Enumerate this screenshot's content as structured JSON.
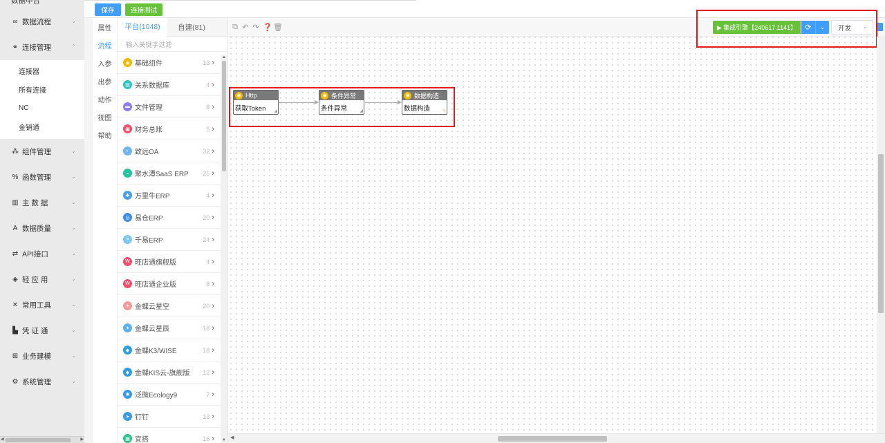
{
  "sidebar": {
    "top_item": "数据中台",
    "items": [
      {
        "label": "数据流程",
        "icon": "infinity-icon",
        "glyph": "∞"
      },
      {
        "label": "连接管理",
        "icon": "link-icon",
        "glyph": "🔗",
        "expanded": true,
        "children": [
          "连接器",
          "所有连接",
          "NC",
          "金销通"
        ]
      },
      {
        "label": "组件管理",
        "icon": "components-icon",
        "glyph": "⁂"
      },
      {
        "label": "函数管理",
        "icon": "function-icon",
        "glyph": "%"
      },
      {
        "label": "主 数 据",
        "icon": "map-icon",
        "glyph": "▥"
      },
      {
        "label": "数据质量",
        "icon": "quality-icon",
        "glyph": "A"
      },
      {
        "label": "API接口",
        "icon": "swap-icon",
        "glyph": "⇄"
      },
      {
        "label": "轻 应 用",
        "icon": "cube-icon",
        "glyph": "◈"
      },
      {
        "label": "常用工具",
        "icon": "tools-icon",
        "glyph": "✕"
      },
      {
        "label": "凭 证 通",
        "icon": "voucher-icon",
        "glyph": "▙"
      },
      {
        "label": "业务建模",
        "icon": "grid-icon",
        "glyph": "⊞"
      },
      {
        "label": "系统管理",
        "icon": "gear-icon",
        "glyph": "⚙"
      }
    ]
  },
  "toolbar": {
    "save_label": "保存",
    "test_label": "连接测试"
  },
  "panel_tabs": [
    "属性",
    "流程",
    "入参",
    "出参",
    "动作",
    "视图",
    "帮助"
  ],
  "components": {
    "tab_platform": "平台(1048)",
    "tab_custom": "自建(81)",
    "search_placeholder": "输入关键字过滤",
    "items": [
      {
        "name": "基础组件",
        "count": "13",
        "color": "#f5b800",
        "glyph": "◉"
      },
      {
        "name": "关系数据库",
        "count": "4",
        "color": "#2ec4c0",
        "glyph": "▤"
      },
      {
        "name": "文件管理",
        "count": "8",
        "color": "#8e7cf0",
        "glyph": "▬"
      },
      {
        "name": "财务总账",
        "count": "5",
        "color": "#f0506e",
        "glyph": "▣"
      },
      {
        "name": "致远OA",
        "count": "32",
        "color": "#6fb3f2",
        "glyph": "◐"
      },
      {
        "name": "聚水潭SaaS ERP",
        "count": "25",
        "color": "#23c39b",
        "glyph": "◒"
      },
      {
        "name": "万里牛ERP",
        "count": "4",
        "color": "#4aa3e8",
        "glyph": "✚"
      },
      {
        "name": "易仓ERP",
        "count": "20",
        "color": "#3d8de6",
        "glyph": "◎"
      },
      {
        "name": "千易ERP",
        "count": "24",
        "color": "#7ec8f0",
        "glyph": "≡"
      },
      {
        "name": "旺店通旗舰版",
        "count": "4",
        "color": "#f0506e",
        "glyph": "W"
      },
      {
        "name": "旺店通企业版",
        "count": "8",
        "color": "#f0506e",
        "glyph": "W"
      },
      {
        "name": "金蝶云星空",
        "count": "20",
        "color": "#f59a9a",
        "glyph": "✦"
      },
      {
        "name": "金蝶云星辰",
        "count": "18",
        "color": "#5ab2ef",
        "glyph": "✦"
      },
      {
        "name": "金蝶K3/WISE",
        "count": "18",
        "color": "#2f9de0",
        "glyph": "◆"
      },
      {
        "name": "金蝶KIS云-旗舰版",
        "count": "12",
        "color": "#2f9de0",
        "glyph": "◆"
      },
      {
        "name": "泛微Ecology9",
        "count": "7",
        "color": "#3b9ae6",
        "glyph": "✺"
      },
      {
        "name": "钉钉",
        "count": "13",
        "color": "#3b9ae6",
        "glyph": "➤"
      },
      {
        "name": "宜搭",
        "count": "16",
        "color": "#2ec48a",
        "glyph": "▦"
      }
    ]
  },
  "canvas_tools": [
    "copy-icon",
    "undo-icon",
    "redo-icon",
    "help-icon",
    "delete-icon"
  ],
  "engine": {
    "label": "▶ 集成引擎【240617.1141】",
    "refresh_glyph": "⟳",
    "dropdown_glyph": "⌄"
  },
  "env_select": {
    "value": "开发"
  },
  "flow": {
    "nodes": [
      {
        "type": "Http",
        "label": "获取Token"
      },
      {
        "type": "条件异常",
        "label": "条件异常"
      },
      {
        "type": "数据构造",
        "label": "数据构造"
      }
    ]
  }
}
